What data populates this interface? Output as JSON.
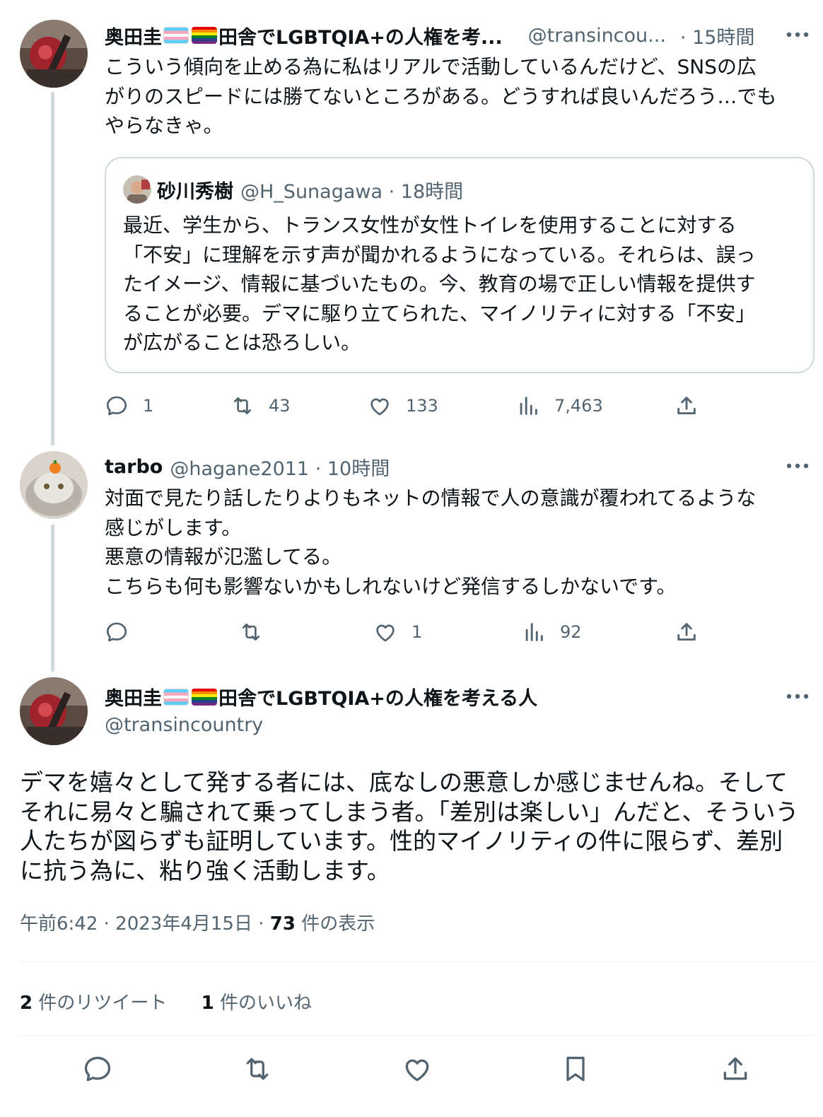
{
  "tweet1": {
    "author_name": "奥田圭",
    "author_name_tail": "田舎でLGBTQIA+の人権を考...",
    "handle": "@transincou...",
    "time": "· 15時間",
    "text_lines": [
      "こういう傾向を止める為に私はリアルで活動しているんだけど、SNSの広",
      "がりのスピードには勝てないところがある。どうすれば良いんだろう…でも",
      "やらなきゃ。"
    ],
    "quote": {
      "author_name": "砂川秀樹",
      "handle_time": "@H_Sunagawa · 18時間",
      "text_lines": [
        "最近、学生から、トランス女性が女性トイレを使用することに対する",
        "「不安」に理解を示す声が聞かれるようになっている。それらは、誤っ",
        "たイメージ、情報に基づいたもの。今、教育の場で正しい情報を提供す",
        "ることが必要。デマに駆り立てられた、マイノリティに対する「不安」",
        "が広がることは恐ろしい。"
      ]
    },
    "replies": "1",
    "retweets": "43",
    "likes": "133",
    "views": "7,463"
  },
  "tweet2": {
    "author_name": "tarbo",
    "handle_time": "@hagane2011 · 10時間",
    "text_lines": [
      "対面で見たり話したりよりもネットの情報で人の意識が覆われてるような",
      "感じがします。",
      "悪意の情報が氾濫してる。",
      "こちらも何も影響ないかもしれないけど発信するしかないです。"
    ],
    "replies": "",
    "retweets": "",
    "likes": "1",
    "views": "92"
  },
  "main_tweet": {
    "author_name": "奥田圭",
    "author_name_tail": "田舎でLGBTQIA+の人権を考える人",
    "handle": "@transincountry",
    "text_lines": [
      "デマを嬉々として発する者には、底なしの悪意しか感じませんね。そして",
      "それに易々と騙されて乗ってしまう者。「差別は楽しい」んだと、そういう",
      "人たちが図らずも証明しています。性的マイノリティの件に限らず、差別",
      "に抗う為に、粘り強く活動します。"
    ],
    "timestamp": "午前6:42 · 2023年4月15日 · ",
    "view_count": "73",
    "view_label": " 件の表示",
    "retweet_count": "2",
    "retweet_label": " 件のリツイート",
    "like_count": "1",
    "like_label": " 件のいいね"
  },
  "icons": {
    "reply": "reply-icon",
    "retweet": "retweet-icon",
    "like": "heart-icon",
    "views": "views-icon",
    "share": "share-icon",
    "bookmark": "bookmark-icon",
    "more": "more-icon"
  },
  "colors": {
    "text": "#0f1419",
    "muted": "#536471",
    "border": "#cfd9de"
  }
}
